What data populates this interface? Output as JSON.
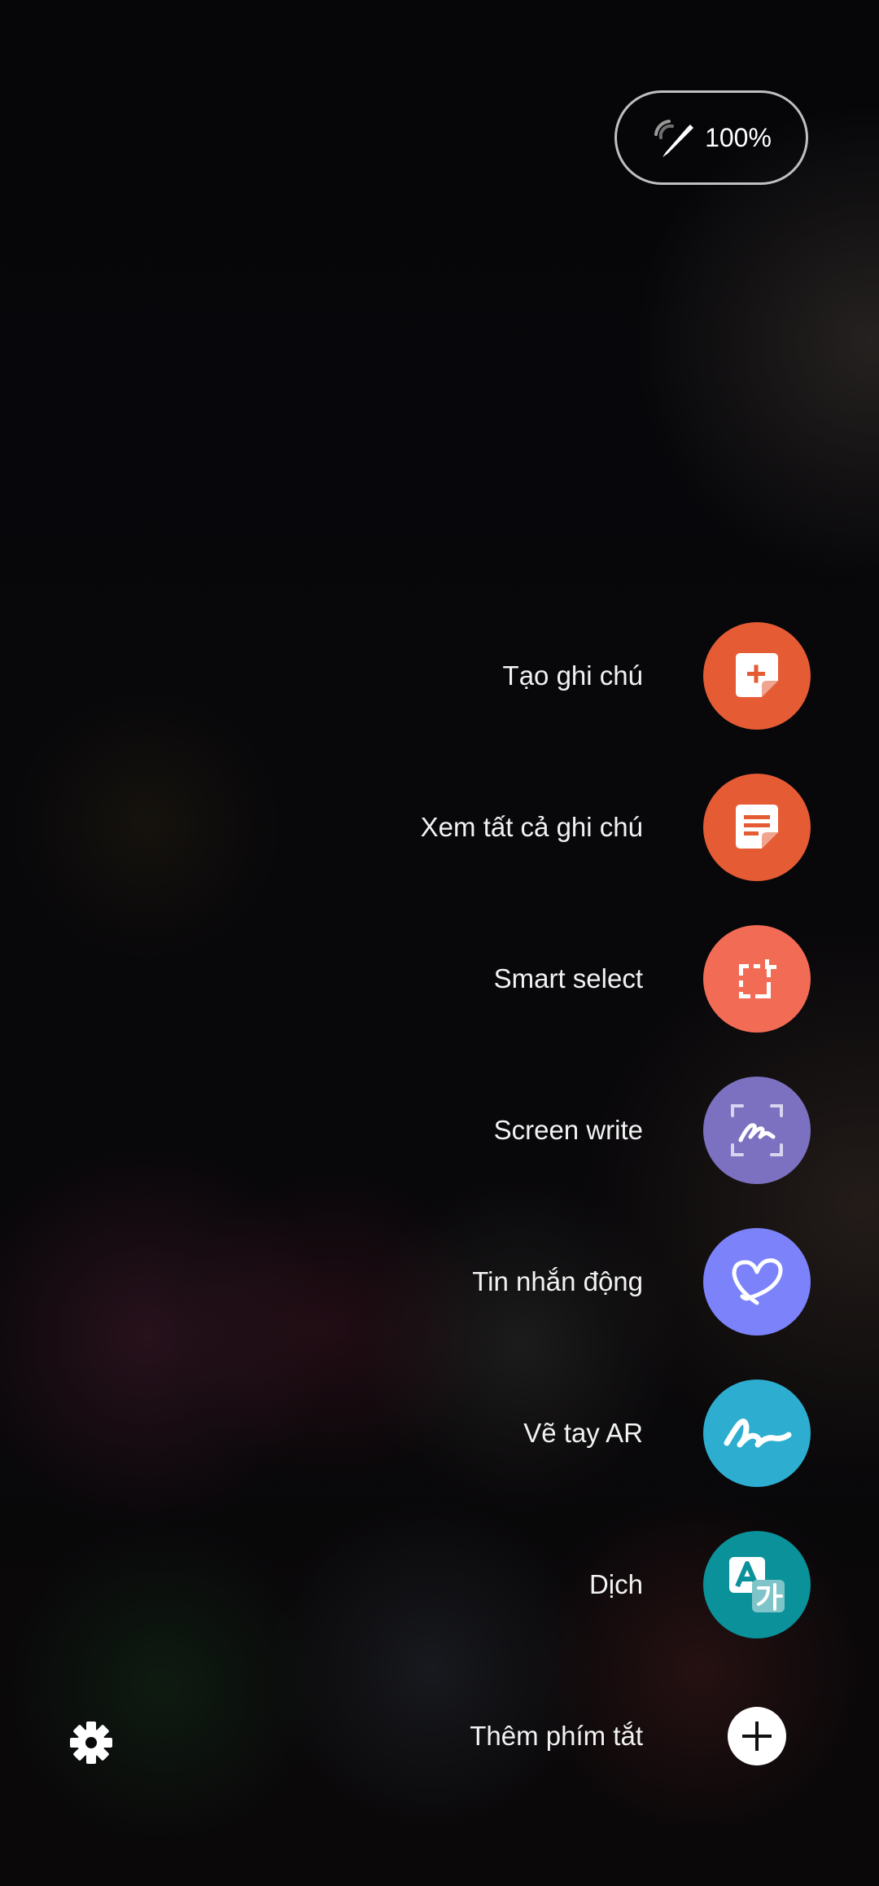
{
  "status": {
    "battery_text": "100%",
    "icon": "pen-battery-icon"
  },
  "shortcuts": [
    {
      "label": "Tạo ghi chú",
      "icon": "create-note-icon",
      "color": "#E45B34"
    },
    {
      "label": "Xem tất cả ghi chú",
      "icon": "view-all-notes-icon",
      "color": "#E45B34"
    },
    {
      "label": "Smart select",
      "icon": "smart-select-icon",
      "color": "#F26B55"
    },
    {
      "label": "Screen write",
      "icon": "screen-write-icon",
      "color": "#7B71C0"
    },
    {
      "label": "Tin nhắn động",
      "icon": "live-message-icon",
      "color": "#7C83FA"
    },
    {
      "label": "Vẽ tay AR",
      "icon": "ar-doodle-icon",
      "color": "#2DADCF"
    },
    {
      "label": "Dịch",
      "icon": "translate-icon",
      "color": "#0B9199"
    }
  ],
  "add_shortcut": {
    "label": "Thêm phím tắt",
    "icon": "plus-icon"
  },
  "settings": {
    "icon": "gear-icon"
  },
  "colors": {
    "background": "#060609",
    "text": "#F2F2F2",
    "pill_border": "#E1E1E1"
  }
}
